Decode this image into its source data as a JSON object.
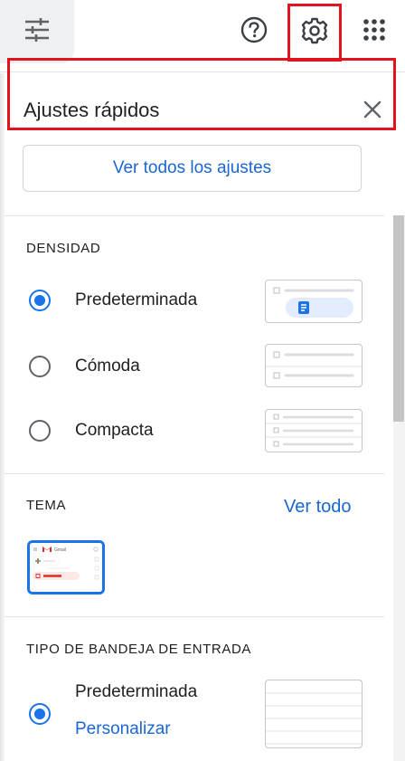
{
  "topbar": {
    "tune_icon": "tune-icon",
    "help_icon": "help-circle-icon",
    "settings_icon": "gear-icon",
    "apps_icon": "apps-grid-icon"
  },
  "panel": {
    "title": "Ajustes rápidos",
    "close_icon": "close-icon",
    "all_settings_label": "Ver todos los ajustes"
  },
  "density": {
    "heading": "DENSIDAD",
    "options": [
      {
        "label": "Predeterminada",
        "selected": true
      },
      {
        "label": "Cómoda",
        "selected": false
      },
      {
        "label": "Compacta",
        "selected": false
      }
    ]
  },
  "theme": {
    "heading": "TEMA",
    "see_all_label": "Ver todo",
    "thumbnail_app_label": "Gmail"
  },
  "inbox_type": {
    "heading": "TIPO DE BANDEJA DE ENTRADA",
    "options": [
      {
        "label": "Predeterminada",
        "selected": true,
        "link": "Personalizar"
      }
    ]
  },
  "colors": {
    "accent": "#1a73e8",
    "link": "#1a66d2",
    "highlight": "#e0141e",
    "text": "#202124",
    "icon": "#5f6368"
  }
}
